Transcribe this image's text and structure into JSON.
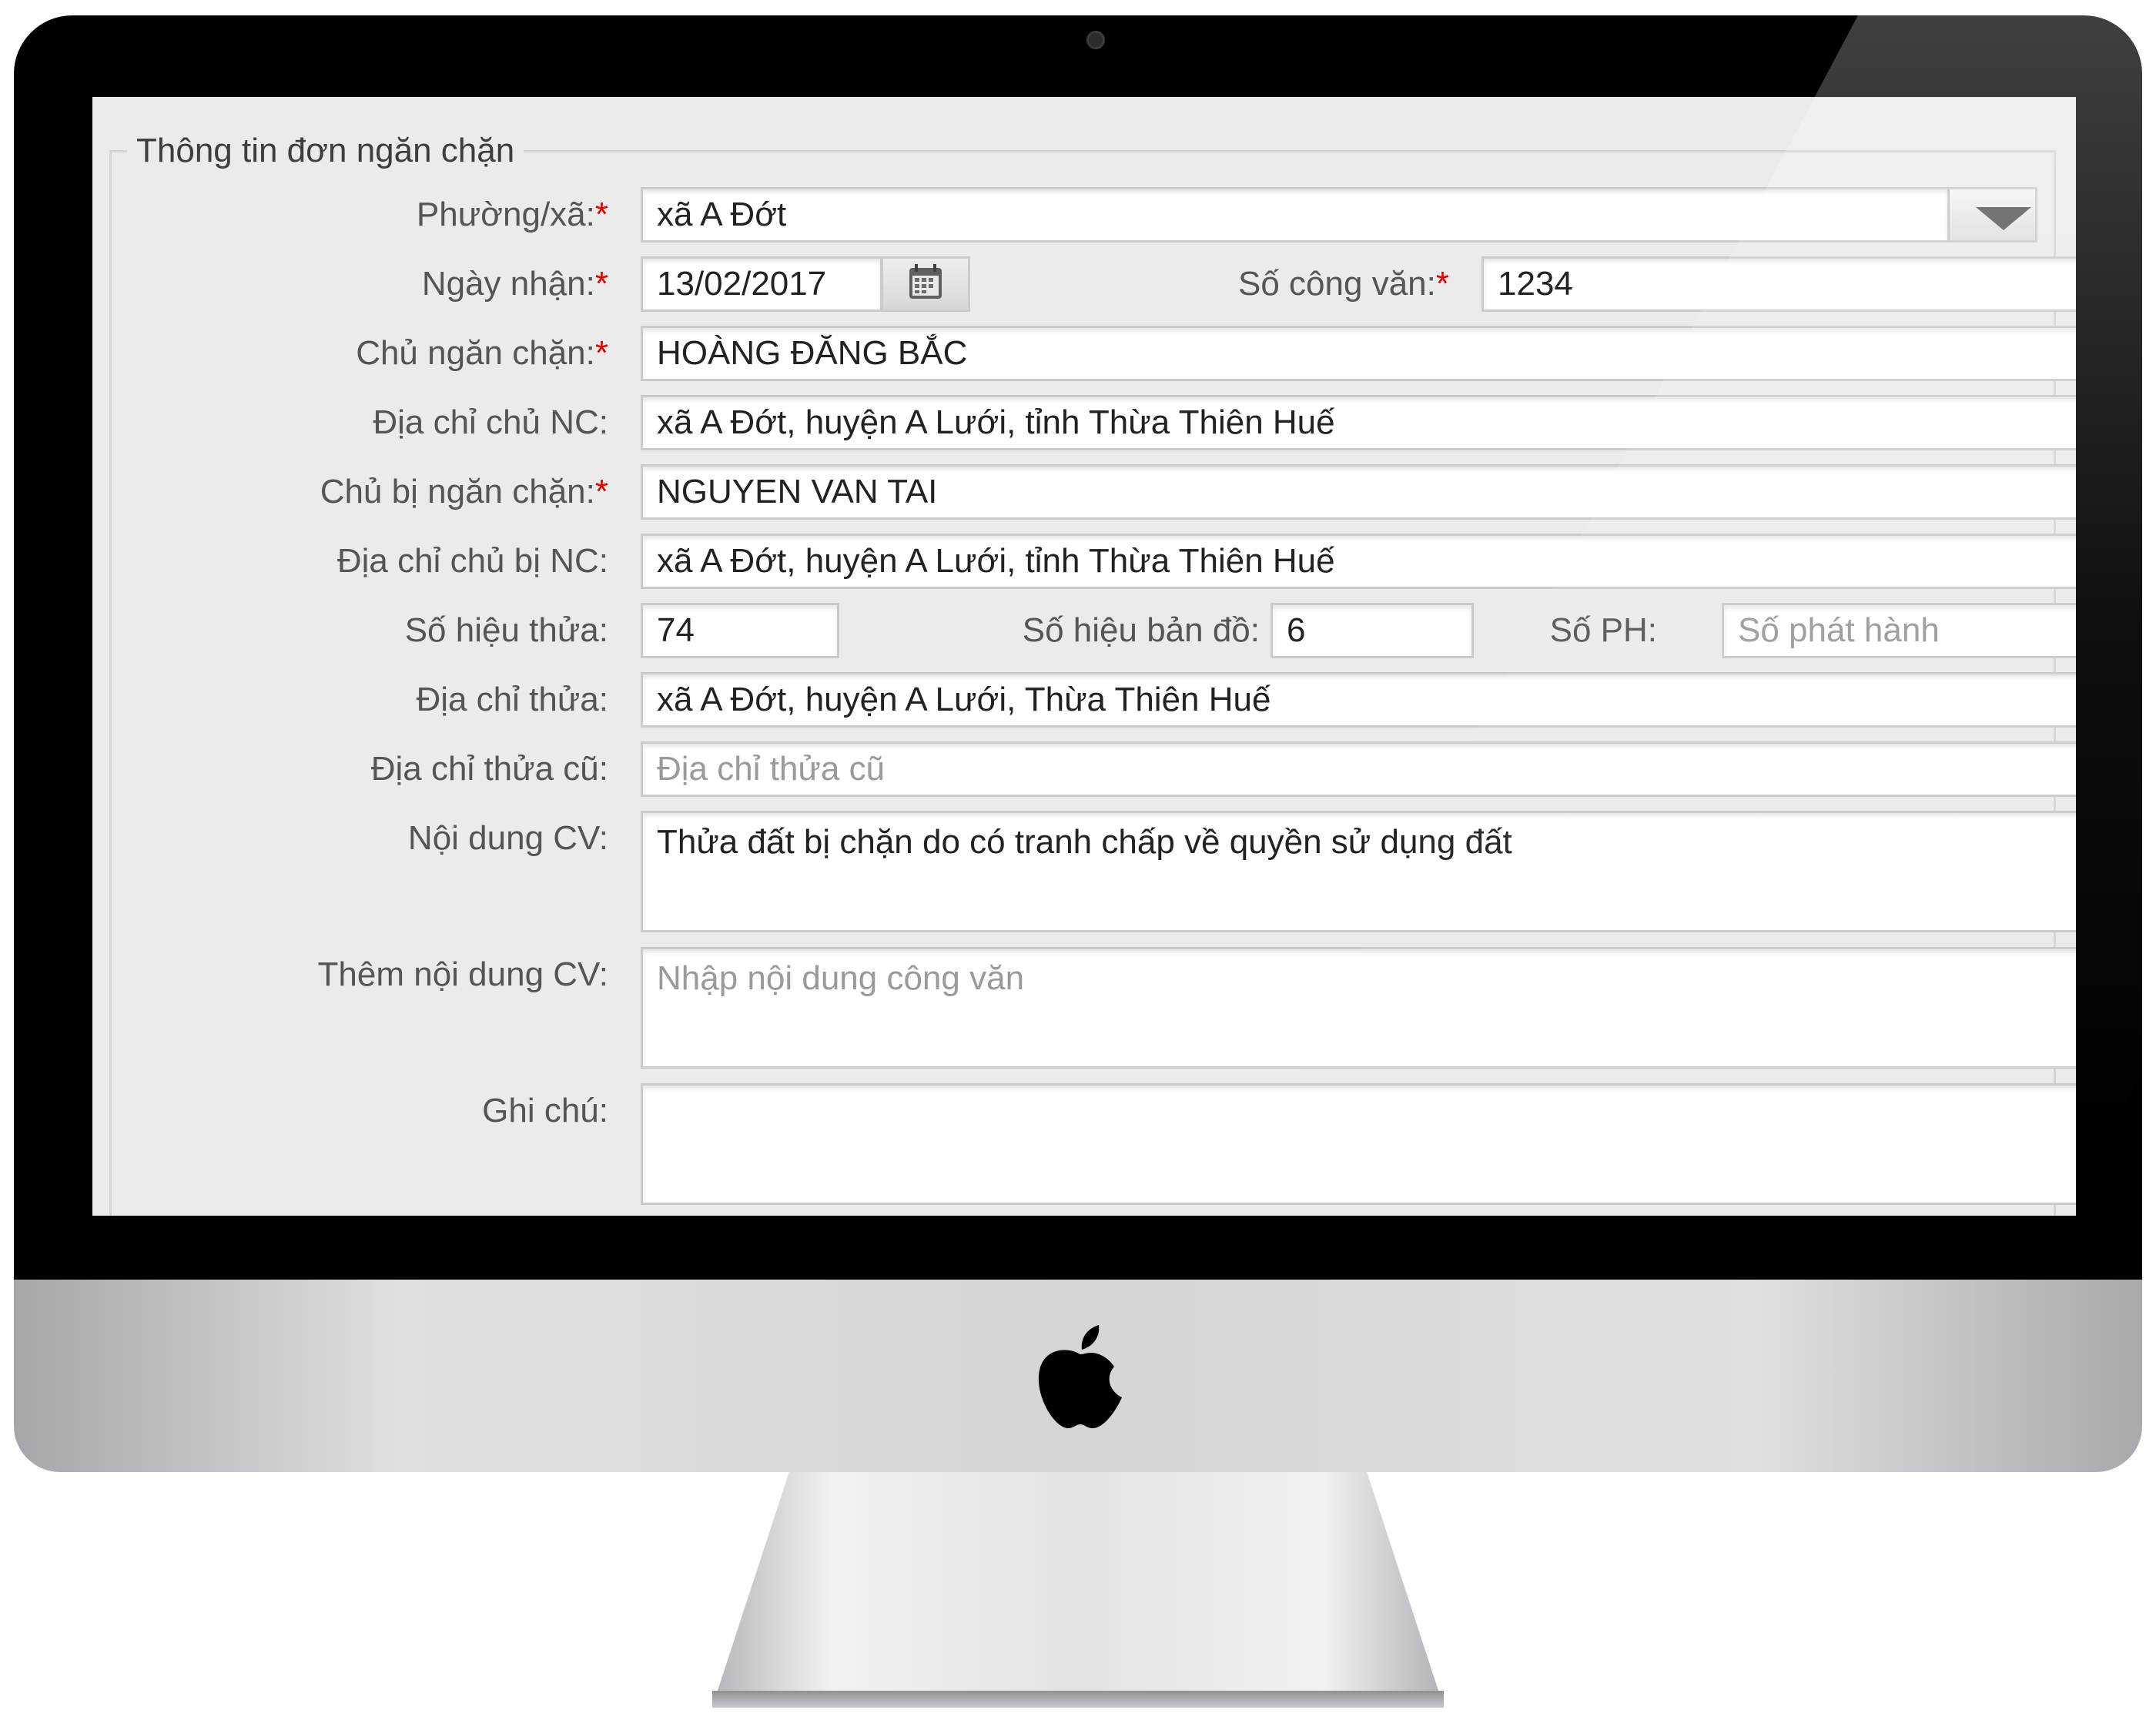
{
  "form": {
    "legend": "Thông tin đơn ngăn chặn",
    "required_mark": "*",
    "ward": {
      "label": "Phường/xã:",
      "value": "xã A Đớt"
    },
    "received_date": {
      "label": "Ngày nhận:",
      "value": "13/02/2017"
    },
    "document_number": {
      "label": "Số công văn:",
      "value": "1234"
    },
    "blocker_owner": {
      "label": "Chủ ngăn chặn:",
      "value": "HOÀNG ĐĂNG BẮC"
    },
    "blocker_address": {
      "label": "Địa chỉ chủ NC:",
      "value": "xã A Đớt, huyện A Lưới, tỉnh Thừa Thiên Huế"
    },
    "blocked_owner": {
      "label": "Chủ bị ngăn chặn:",
      "value": "NGUYEN VAN TAI"
    },
    "blocked_address": {
      "label": "Địa chỉ chủ bị NC:",
      "value": "xã A Đớt, huyện A Lưới, tỉnh Thừa Thiên Huế"
    },
    "parcel_number": {
      "label": "Số hiệu thửa:",
      "value": "74"
    },
    "map_number": {
      "label": "Số hiệu bản đồ:",
      "value": "6"
    },
    "issue_number": {
      "label": "Số PH:",
      "placeholder": "Số phát hành"
    },
    "parcel_address": {
      "label": "Địa chỉ thửa:",
      "value": "xã A Đớt, huyện A Lưới, Thừa Thiên Huế"
    },
    "old_parcel_address": {
      "label": "Địa chỉ thửa cũ:",
      "placeholder": "Địa chỉ thửa cũ"
    },
    "document_content": {
      "label": "Nội dung CV:",
      "value": "Thửa đất bị chặn do có tranh chấp về quyền sử dụng đất"
    },
    "extra_content": {
      "label": "Thêm nội dung CV:",
      "placeholder": "Nhập nội dung công văn"
    },
    "note": {
      "label": "Ghi chú:",
      "value": ""
    }
  },
  "icons": {
    "dropdown": "chevron-down-icon",
    "calendar": "calendar-icon",
    "brand": "apple-logo-icon"
  },
  "colors": {
    "required": "#e20000",
    "label": "#555555",
    "placeholder": "#9a9a9a",
    "bezel": "#000000"
  }
}
